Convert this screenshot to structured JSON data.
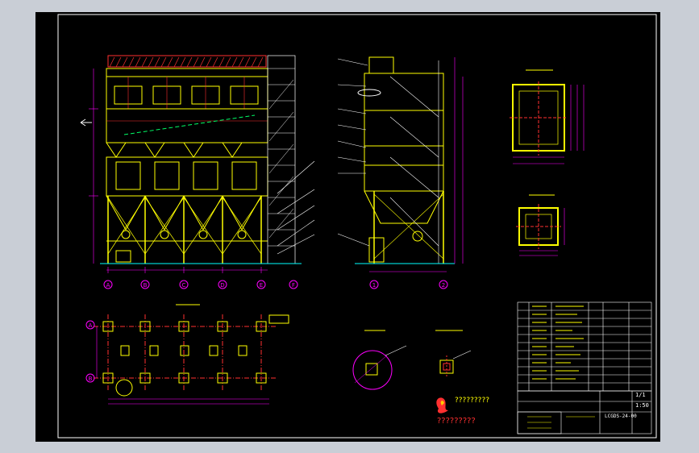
{
  "drawing": {
    "background": "#000000",
    "frame_color": "#ffffff",
    "colors": {
      "structure": "#ffff00",
      "dimension": "#ff00ff",
      "leader": "#ffffff",
      "ground": "#00ffff",
      "axis_bubble": "#ff00ff",
      "hatch_red": "#ff3030",
      "flue_green": "#00ff66"
    },
    "axis_labels": [
      "A",
      "B",
      "C",
      "D",
      "E",
      "F"
    ],
    "side_axis_labels": [
      "1",
      "2"
    ],
    "plan_axis_labels": [
      "A",
      "B"
    ],
    "logo_text": "?????????",
    "logo_caption": "?????????",
    "title_block": {
      "project_code": "LCGDS-24-00",
      "sheet": "1/1",
      "scale": "1:50"
    }
  }
}
